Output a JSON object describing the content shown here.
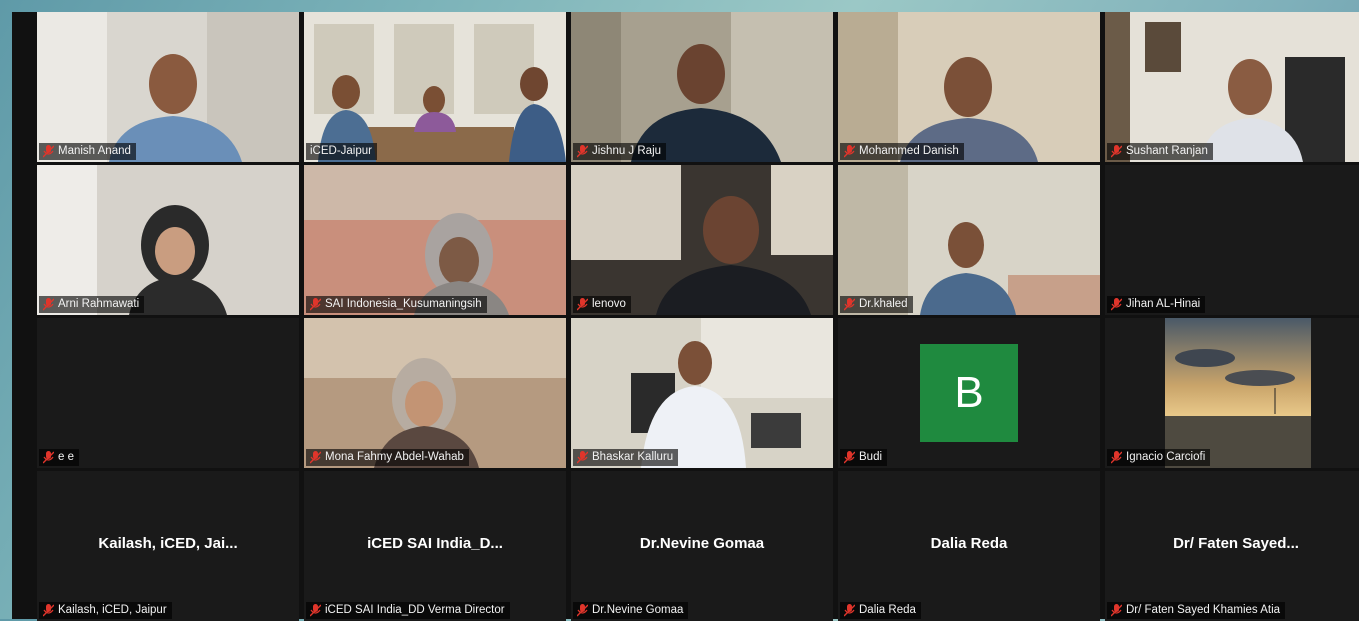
{
  "meeting": {
    "participants": [
      {
        "name": "Manish Anand",
        "muted": true
      },
      {
        "name": "iCED-Jaipur",
        "muted": false,
        "active_speaker": true
      },
      {
        "name": "Jishnu J Raju",
        "muted": true
      },
      {
        "name": "Mohammed Danish",
        "muted": true
      },
      {
        "name": "Sushant Ranjan",
        "muted": true
      },
      {
        "name": "Arni Rahmawati",
        "muted": true
      },
      {
        "name": "SAI Indonesia_Kusumaningsih",
        "muted": true
      },
      {
        "name": "lenovo",
        "muted": true
      },
      {
        "name": "Dr.khaled",
        "muted": true
      },
      {
        "name": "Jihan AL-Hinai",
        "muted": true
      },
      {
        "name": "e e",
        "muted": true
      },
      {
        "name": "Mona Fahmy Abdel-Wahab",
        "muted": true
      },
      {
        "name": "Bhaskar Kalluru",
        "muted": true
      },
      {
        "name": "Budi",
        "muted": true,
        "avatar_letter": "B",
        "avatar_color": "#1f8a3f"
      },
      {
        "name": "Ignacio Carciofi",
        "muted": true
      },
      {
        "name": "Kailash, iCED, Jaipur",
        "muted": true,
        "display_title": "Kailash, iCED, Jai..."
      },
      {
        "name": "iCED SAI India_DD Verma Director",
        "muted": true,
        "display_title": "iCED SAI India_D..."
      },
      {
        "name": "Dr.Nevine Gomaa",
        "muted": true,
        "display_title": "Dr.Nevine Gomaa"
      },
      {
        "name": "Dalia Reda",
        "muted": true,
        "display_title": "Dalia Reda"
      },
      {
        "name": "Dr/ Faten Sayed Khamies Atia",
        "muted": true,
        "display_title": "Dr/ Faten Sayed..."
      }
    ],
    "icons": {
      "muted": "muted-mic-icon"
    },
    "colors": {
      "active_speaker_border": "#e8e05a",
      "muted_icon": "#e0352b",
      "tile_bg": "#1a1a1a"
    }
  }
}
